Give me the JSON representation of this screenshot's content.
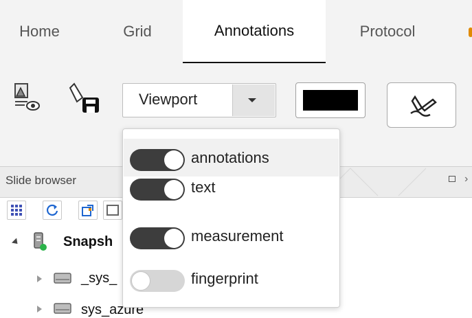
{
  "tabs": [
    {
      "label": "Home",
      "active": false
    },
    {
      "label": "Grid",
      "active": false
    },
    {
      "label": "Annotations",
      "active": true
    },
    {
      "label": "Protocol",
      "active": false
    }
  ],
  "toolbar": {
    "viewport_label": "Viewport",
    "color_value": "#000000",
    "icons": [
      "annotation-visibility-icon",
      "annotation-save-icon",
      "draw-annotation-icon"
    ]
  },
  "dropdown": {
    "items": [
      {
        "label": "annotations",
        "on": true
      },
      {
        "label": "text",
        "on": true
      },
      {
        "label": "measurement",
        "on": true
      },
      {
        "label": "fingerprint",
        "on": false
      }
    ]
  },
  "slide_browser": {
    "title": "Slide browser",
    "tools": [
      "grid-icon",
      "refresh-icon",
      "export-icon",
      "image-icon"
    ],
    "tree": [
      {
        "label": "Snapsh",
        "level": 0,
        "expanded": true
      },
      {
        "label": "_sys_",
        "level": 1,
        "expanded": false
      },
      {
        "label": "sys_azure",
        "level": 1,
        "expanded": false
      }
    ]
  },
  "colors": {
    "tab_bg": "#f3f3f3",
    "toggle_on": "#3d3d3d",
    "toggle_off": "#d6d6d6",
    "status_green": "#2bb34a"
  }
}
